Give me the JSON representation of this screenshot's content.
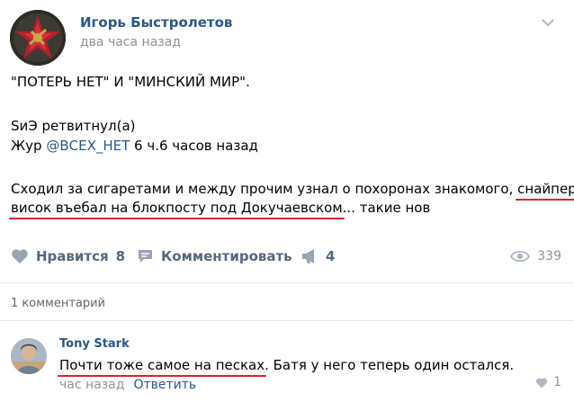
{
  "post": {
    "author": "Игорь Быстролетов",
    "time": "два часа назад",
    "line1": "\"ПОТЕРЬ НЕТ\" И \"МИНСКИЙ МИР\".",
    "retweet": "SиЭ ретвитнул(а)",
    "journal_prefix": "Жур ",
    "journal_handle": "@ВСЕХ_НЕТ",
    "journal_suffix": " 6 ч.6 часов назад",
    "body_l1_plain": "Сходил за сигаретами и между прочим узнал о похоронах знакомого, ",
    "body_l1_underlined": "снайпер в",
    "body_l2_underlined": "висок въебал на блокпосту под Докучаевском",
    "body_l2_tail": "... такие нов"
  },
  "actions": {
    "like_label": "Нравится",
    "like_count": "8",
    "comment_label": "Комментировать",
    "share_count": "4",
    "views": "339"
  },
  "comments": {
    "count_label": "1 комментарий",
    "items": [
      {
        "author": "Tony Stark",
        "text_underlined": "Почти тоже самое на песках",
        "text_tail": ". Батя у него теперь один остался.",
        "time": "час назад",
        "reply_label": "Ответить",
        "likes": "1"
      }
    ]
  },
  "colors": {
    "link": "#2a5885",
    "action": "#55677d",
    "muted": "#939393",
    "underline": "#e0222b"
  }
}
